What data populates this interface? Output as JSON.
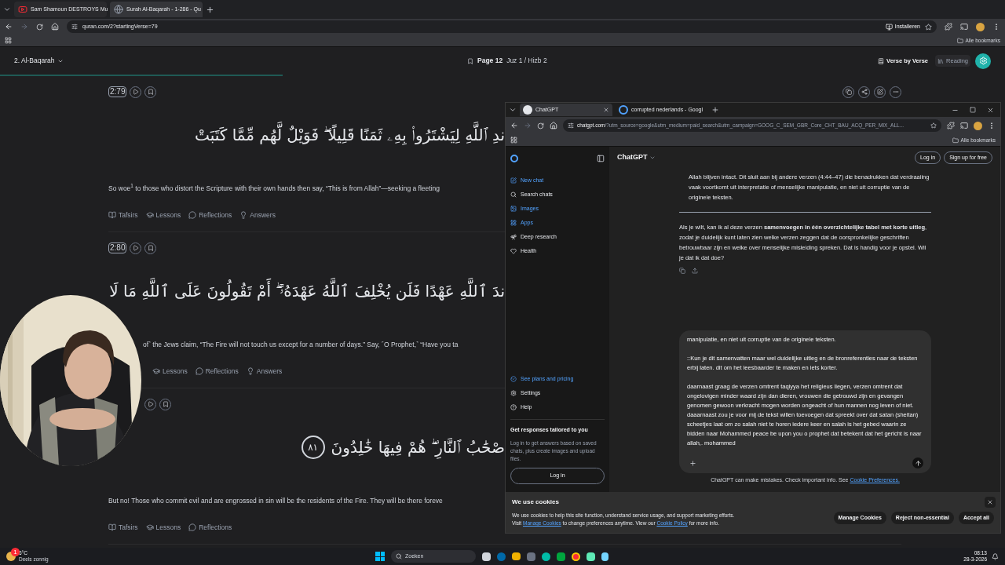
{
  "browser": {
    "tabs": [
      {
        "title": "Sam Shamoun DESTROYS Mu",
        "kind": "video",
        "selected": false
      },
      {
        "title": "Surah Al-Baqarah - 1-286 - Qu",
        "kind": "site",
        "selected": true
      }
    ],
    "url": "quran.com/2?startingVerse=79",
    "install_label": "Installeren",
    "bookmarks_label": "Alle bookmarks"
  },
  "quran": {
    "surah": "2. Al-Baqarah",
    "page": "Page 12",
    "juz": "Juz 1 / Hizb 2",
    "views": [
      {
        "label": "Verse by Verse",
        "kind": "verse",
        "selected": true
      },
      {
        "label": "Reading",
        "kind": "reading",
        "selected": false
      }
    ],
    "verses": [
      {
        "key": "2:79",
        "tools": true,
        "arabic": "ندِ ٱللَّهِ لِيَشْتَرُوا۟ بِهِۦ ثَمَنًا قَلِيلًا ۖ فَوَيْلٌ لَّهُم مِّمَّا كَتَبَتْ",
        "translation": "So woe$^{1}$ to those who distort the Scripture with their own hands then say, “This is from Allah”—seeking a fleeting",
        "covered": false,
        "actions": [
          {
            "kind": "tafsirs",
            "label": "Tafsirs"
          },
          {
            "kind": "lessons",
            "label": "Lessons"
          },
          {
            "kind": "reflections",
            "label": "Reflections"
          },
          {
            "kind": "answers",
            "label": "Answers"
          }
        ]
      },
      {
        "key": "2:80",
        "arabic": "ندَ ٱللَّهِ عَهْدًا فَلَن يُخْلِفَ ٱللَّهُ عَهْدَهُۥٓ ۖ أَمْ تَقُولُونَ عَلَى ٱللَّهِ مَا لَا",
        "translation": "of˺ the Jews claim, “The Fire will not touch us except for a number of days.” Say, ˹O Prophet,˺ “Have you ta",
        "covered": true,
        "actions": [
          {
            "kind": "lessons",
            "label": "Lessons"
          },
          {
            "kind": "reflections",
            "label": "Reflections"
          },
          {
            "kind": "answers",
            "label": "Answers"
          }
        ]
      },
      {
        "arabic": "صْحَٰبُ ٱلنَّارِ ۖ هُمْ فِيهَا خَٰلِدُونَ",
        "number": "٨١",
        "translation": "But no! Those who commit evil and are engrossed in sin will be the residents of the Fire. They will be there foreve",
        "actions": [
          {
            "kind": "tafsirs",
            "label": "Tafsirs"
          },
          {
            "kind": "lessons",
            "label": "Lessons"
          },
          {
            "kind": "reflections",
            "label": "Reflections"
          }
        ]
      }
    ]
  },
  "chatgpt": {
    "tabs": [
      {
        "title": "ChatGPT",
        "kind": "chatgpt",
        "selected": true
      },
      {
        "title": "corrupted nederlands - Googl",
        "kind": "google",
        "selected": false
      }
    ],
    "url_host": "chatgpt.com",
    "url_rest": "/?utm_source=google&utm_medium=paid_search&utm_campaign=GOOG_C_SEM_GBR_Core_CHT_BAU_ACQ_PER_MIX_ALL...",
    "bookmarks_label": "Alle bookmarks",
    "sidebar": [
      {
        "kind": "new",
        "label": "New chat",
        "highlight": true
      },
      {
        "kind": "search",
        "label": "Search chats",
        "highlight": false
      },
      {
        "kind": "images",
        "label": "Images",
        "highlight": true
      },
      {
        "kind": "apps",
        "label": "Apps",
        "highlight": true
      },
      {
        "kind": "research",
        "label": "Deep research",
        "highlight": false
      },
      {
        "kind": "health",
        "label": "Health",
        "highlight": false
      }
    ],
    "sidebar_bottom": [
      {
        "kind": "plans",
        "label": "See plans and pricing",
        "highlight": true
      },
      {
        "kind": "settings",
        "label": "Settings",
        "highlight": false
      },
      {
        "kind": "help",
        "label": "Help",
        "highlight": false
      }
    ],
    "promo_title": "Get responses tailored to you",
    "promo_text": "Log in to get answers based on saved chats, plus create images and upload files.",
    "sidebar_login": "Log in",
    "model": "ChatGPT",
    "login": "Log in",
    "signup": "Sign up for free",
    "messages": [
      "Allah blijven intact. Dit sluit aan bij andere verzen (4:44–47) die benadrukken dat verdraaiing vaak voortkomt uit interpretatie of menselijke manipulatie, en niet uit corruptie van de originele teksten.",
      "Als je wilt, kan ik al deze verzen **samenvoegen in één overzichtelijke tabel met korte uitleg**, zodat je duidelijk kunt laten zien welke verzen zeggen dat de oorspronkelijke geschriften betrouwbaar zijn en welke over menselijke misleiding spreken. Dat is handig voor je opstel. Wil je dat ik dat doe?"
    ],
    "composer": [
      "manipulatie, en niet uit corruptie van de originele teksten.",
      "::Kun je dit samenvatten maar wel duidelijke uitleg en de bronreferenties naar de teksten erbij laten. dit om het leesbaarder te maken en iets korter.",
      "daarnaast graag de verzen omtrent taqiyya het religieus liegen, verzen omtrent dat ongelovigen minder waard zijn dan dieren, vrouwen die getrouwd zijn en gevangen genomen gewoon verkracht mogen worden ongeacht of hun mannen nog leven of niet. daaarnaast zou je voor mij de tekst willen toevoegen dat spreekt over dat satan (sheitan) scheetjes laat om zo salah niet te horen iedere keer en salah is het gebed waarin ze bidden naar Mohammed peace be upon you o prophet dat betekent dat het gericht is naar allah,. mohammed"
    ],
    "disclaimer": "ChatGPT can make mistakes. Check important info. See",
    "disclaimer_link": "Cookie Preferences.",
    "cookies": {
      "title": "We use cookies",
      "line1": "We use cookies to help this site function, understand service usage, and support marketing efforts.",
      "before": "Visit",
      "link1": "Manage Cookies",
      "middle": "to change preferences anytime. View our",
      "link2": "Cookie Policy",
      "after": "for more info.",
      "buttons": [
        "Manage Cookies",
        "Reject non-essential",
        "Accept all"
      ]
    }
  },
  "taskbar": {
    "temperature": "6°C",
    "weather": "Deels zonnig",
    "badge": "1",
    "search_placeholder": "Zoeken",
    "time": "08:13",
    "date": "28-3-2026"
  }
}
